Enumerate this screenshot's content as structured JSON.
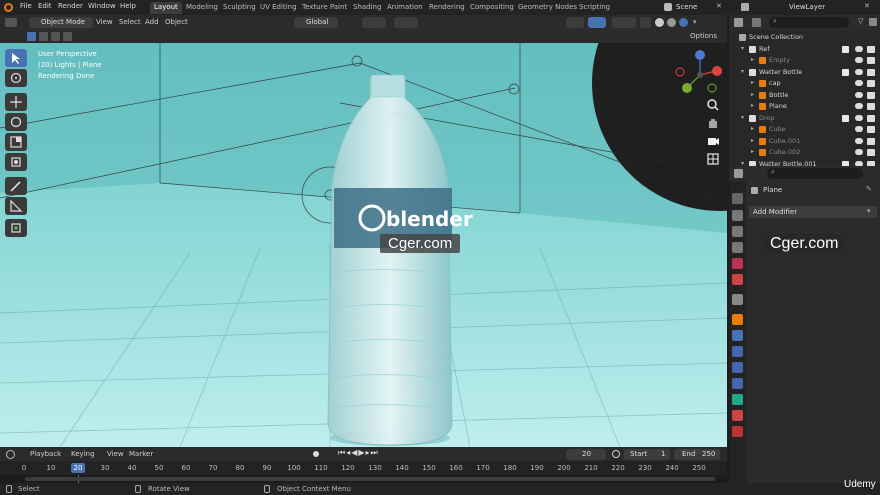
{
  "menus": [
    "File",
    "Edit",
    "Render",
    "Window",
    "Help"
  ],
  "workspaces": [
    "Layout",
    "Modeling",
    "Sculpting",
    "UV Editing",
    "Texture Paint",
    "Shading",
    "Animation",
    "Rendering",
    "Compositing",
    "Geometry Nodes",
    "Scripting"
  ],
  "scene_name": "Scene",
  "view_layer_name": "ViewLayer",
  "viewport_header": {
    "mode": "Object Mode",
    "menus": [
      "View",
      "Select",
      "Add",
      "Object"
    ],
    "orientation": "Global",
    "options_label": "Options"
  },
  "overlay_text": {
    "line1": "User Perspective",
    "line2": "(20) Lights | Plane",
    "line3": "Rendering Done"
  },
  "bottle_logo": "blender",
  "watermark": "Cger.com",
  "outliner": {
    "rows": [
      {
        "label": "Scene Collection",
        "indent": 0,
        "selected": false
      },
      {
        "label": "Ref",
        "indent": 1,
        "selected": false
      },
      {
        "label": "Empty",
        "indent": 2,
        "selected": false
      },
      {
        "label": "Watter Bottle",
        "indent": 1,
        "selected": false
      },
      {
        "label": "cap",
        "indent": 2,
        "selected": false
      },
      {
        "label": "Bottle",
        "indent": 2,
        "selected": false
      },
      {
        "label": "Plane",
        "indent": 2,
        "selected": false
      },
      {
        "label": "Drop",
        "indent": 1,
        "selected": false
      },
      {
        "label": "Cube",
        "indent": 2,
        "selected": false
      },
      {
        "label": "Cube.001",
        "indent": 2,
        "selected": false
      },
      {
        "label": "Cube.002",
        "indent": 2,
        "selected": false
      },
      {
        "label": "Watter Bottle.001",
        "indent": 1,
        "selected": false
      }
    ]
  },
  "properties": {
    "object_name": "Plane",
    "add_modifier": "Add Modifier"
  },
  "timeline": {
    "menus": [
      "Playback",
      "Keying",
      "View",
      "Marker"
    ],
    "current_frame": "20",
    "start_label": "Start",
    "start": "1",
    "end_label": "End",
    "end": "250",
    "ticks": [
      "0",
      "10",
      "20",
      "30",
      "40",
      "50",
      "60",
      "70",
      "80",
      "90",
      "100",
      "110",
      "120",
      "130",
      "140",
      "150",
      "160",
      "170",
      "180",
      "190",
      "200",
      "210",
      "220",
      "230",
      "240",
      "250"
    ]
  },
  "statusbar": {
    "select": "Select",
    "rotate": "Rotate View",
    "context": "Object Context Menu"
  },
  "brand_badge": "Udemy",
  "colors": {
    "accent": "#4772b3",
    "floor": "#79cfcf",
    "selected_row": "#334d80"
  }
}
